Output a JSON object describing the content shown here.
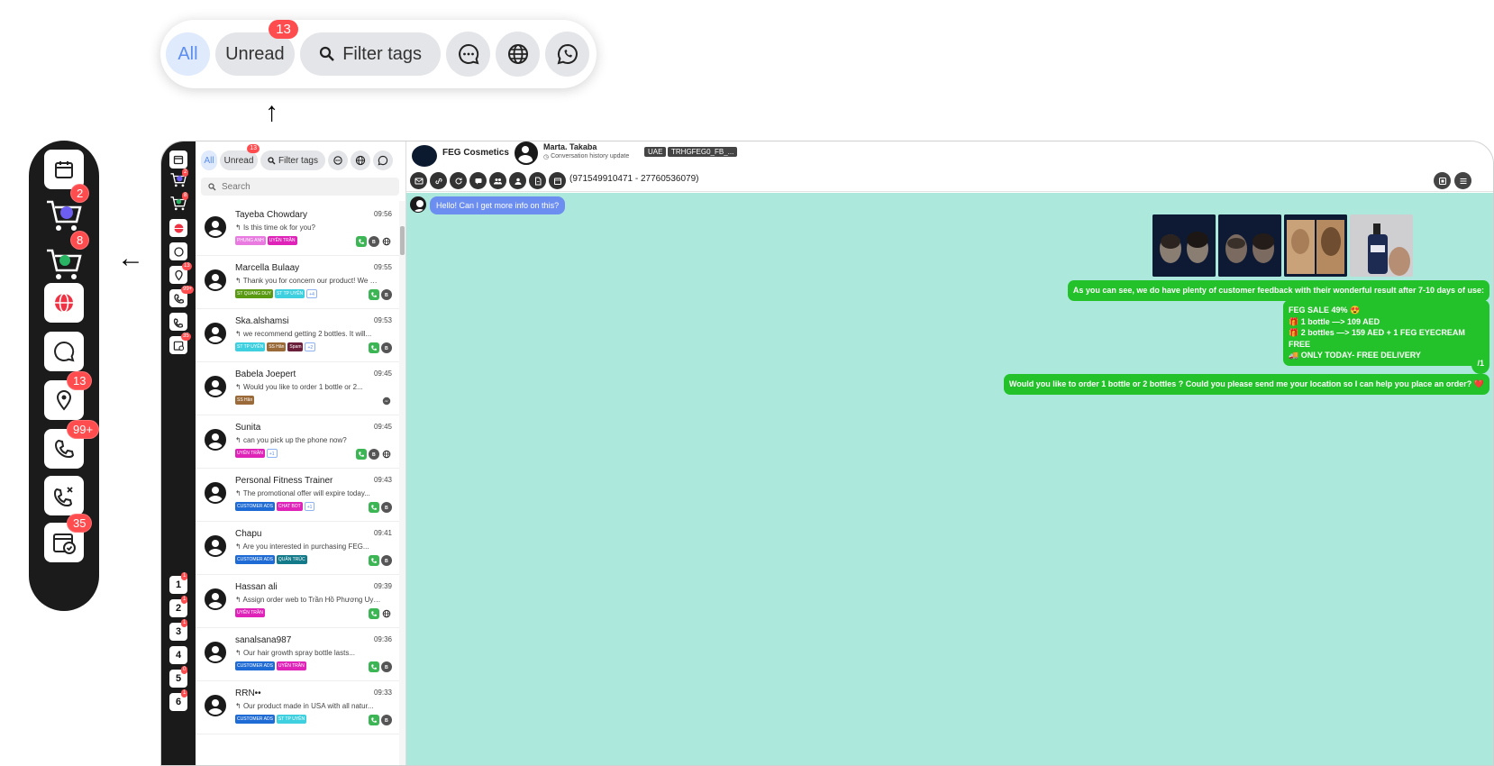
{
  "zoom_filter": {
    "all_label": "All",
    "unread_label": "Unread",
    "unread_count": "13",
    "filter_tags_label": "Filter tags"
  },
  "zoom_rail": {
    "badges": {
      "cart_messenger": "2",
      "cart_green": "8",
      "location": "13",
      "phone": "99+",
      "schedule": "35"
    }
  },
  "app": {
    "filter": {
      "all_label": "All",
      "unread_label": "Unread",
      "unread_count": "13",
      "filter_tags_label": "Filter tags"
    },
    "search": {
      "placeholder": "Search"
    },
    "rail_badges": {
      "cart_messenger": "2",
      "cart_green": "8",
      "location": "13",
      "phone": "99+",
      "schedule": "35"
    },
    "queue_buttons": [
      {
        "label": "1",
        "badge": "1"
      },
      {
        "label": "2",
        "badge": "1"
      },
      {
        "label": "3",
        "badge": "1"
      },
      {
        "label": "4",
        "badge": ""
      },
      {
        "label": "5",
        "badge": "0"
      },
      {
        "label": "6",
        "badge": "1"
      }
    ],
    "conversations": [
      {
        "name": "Tayeba Chowdary",
        "time": "09:56",
        "preview": "Is this time ok for you?",
        "tags": [
          [
            "PHUNG ANH",
            "#e87ae0"
          ],
          [
            "UYÊN TRẦN",
            "#e023b8"
          ]
        ],
        "icons": [
          "phone",
          "b",
          "globe"
        ]
      },
      {
        "name": "Marcella Bulaay",
        "time": "09:55",
        "preview": "Thank you for concern our product! We will...",
        "tags": [
          [
            "ST QUANG DUY",
            "#5a9a12"
          ],
          [
            "ST TP UYÊN",
            "#3fd0e0"
          ],
          [
            "+4",
            "more"
          ]
        ],
        "icons": [
          "phone",
          "b"
        ]
      },
      {
        "name": "Ska.alshamsi",
        "time": "09:53",
        "preview": "we recommend getting 2 bottles. It will...",
        "tags": [
          [
            "ST TP UYÊN",
            "#3fd0e0"
          ],
          [
            "SS Hân",
            "#9a6a38"
          ],
          [
            "Spam",
            "#6a1f3a"
          ],
          [
            "+2",
            "more"
          ]
        ],
        "icons": [
          "phone",
          "b"
        ]
      },
      {
        "name": "Babela Joepert",
        "time": "09:45",
        "preview": "Would you like to order 1 bottle or 2...",
        "tags": [
          [
            "SS Hân",
            "#9a6a38"
          ]
        ],
        "icons": [
          "messenger"
        ]
      },
      {
        "name": "Sunita",
        "time": "09:45",
        "preview": "can you pick up the phone now?",
        "tags": [
          [
            "UYÊN TRẦN",
            "#e023b8"
          ],
          [
            "+1",
            "more"
          ]
        ],
        "icons": [
          "phone",
          "b",
          "globe"
        ]
      },
      {
        "name": "Personal Fitness Trainer",
        "time": "09:43",
        "preview": "The promotional offer will expire today...",
        "tags": [
          [
            "CUSTOMER ADS",
            "#1f6bd6"
          ],
          [
            "CHAT BOT",
            "#e023b8"
          ],
          [
            "+1",
            "more"
          ]
        ],
        "icons": [
          "phone",
          "b"
        ]
      },
      {
        "name": "Chapu",
        "time": "09:41",
        "preview": "Are you interested in purchasing FEG...",
        "tags": [
          [
            "CUSTOMER ADS",
            "#1f6bd6"
          ],
          [
            "QUÂN TRÚC",
            "#137a8a"
          ]
        ],
        "icons": [
          "phone",
          "b"
        ]
      },
      {
        "name": "Hassan ali",
        "time": "09:39",
        "preview": "Assign order web to Trần Hồ Phương Uyên",
        "tags": [
          [
            "UYÊN TRẦN",
            "#e023b8"
          ]
        ],
        "icons": [
          "phone",
          "globe"
        ]
      },
      {
        "name": "sanalsana987",
        "time": "09:36",
        "preview": "Our hair growth spray bottle lasts...",
        "tags": [
          [
            "CUSTOMER ADS",
            "#1f6bd6"
          ],
          [
            "UYÊN TRẦN",
            "#e023b8"
          ]
        ],
        "icons": [
          "phone",
          "b"
        ]
      },
      {
        "name": "RRN••",
        "time": "09:33",
        "preview": "Our product made in USA with all natur...",
        "tags": [
          [
            "CUSTOMER ADS",
            "#1f6bd6"
          ],
          [
            "ST TP UYÊN",
            "#3fd0e0"
          ]
        ],
        "icons": [
          "phone",
          "b"
        ]
      }
    ]
  },
  "chat": {
    "page_name": "FEG Cosmetics",
    "contact_name": "Marta. Takaba",
    "history_label": "Conversation history update",
    "badge_country": "UAE",
    "badge_code": "TRHGFEG0_FB_...",
    "phone_label": "(971549910471 - 27760536079)",
    "incoming_message": "Hello! Can I get more info on this?",
    "msg_feedback": "As you can see, we do have plenty of customer feedback with their wonderful result after 7-10 days of use:",
    "sale_lines": [
      "FEG SALE 49% 😍",
      "🎁 1 bottle —> 109 AED",
      "🎁 2 bottles —> 159 AED + 1 FEG EYECREAM FREE",
      "🚚 ONLY TODAY- FREE DELIVERY"
    ],
    "msg_short": "/1",
    "msg_question": "Would you like to order 1 bottle or 2 bottles ? Could you please send me your location so I can help you place an order? ❤️"
  },
  "colors": {
    "chat_bg": "#ace9dc",
    "outgoing_bubble": "#23c22a",
    "incoming_bubble": "#6b8ef0",
    "badge_red": "#ff4d4f",
    "rail_bg": "#1a1a1a"
  }
}
